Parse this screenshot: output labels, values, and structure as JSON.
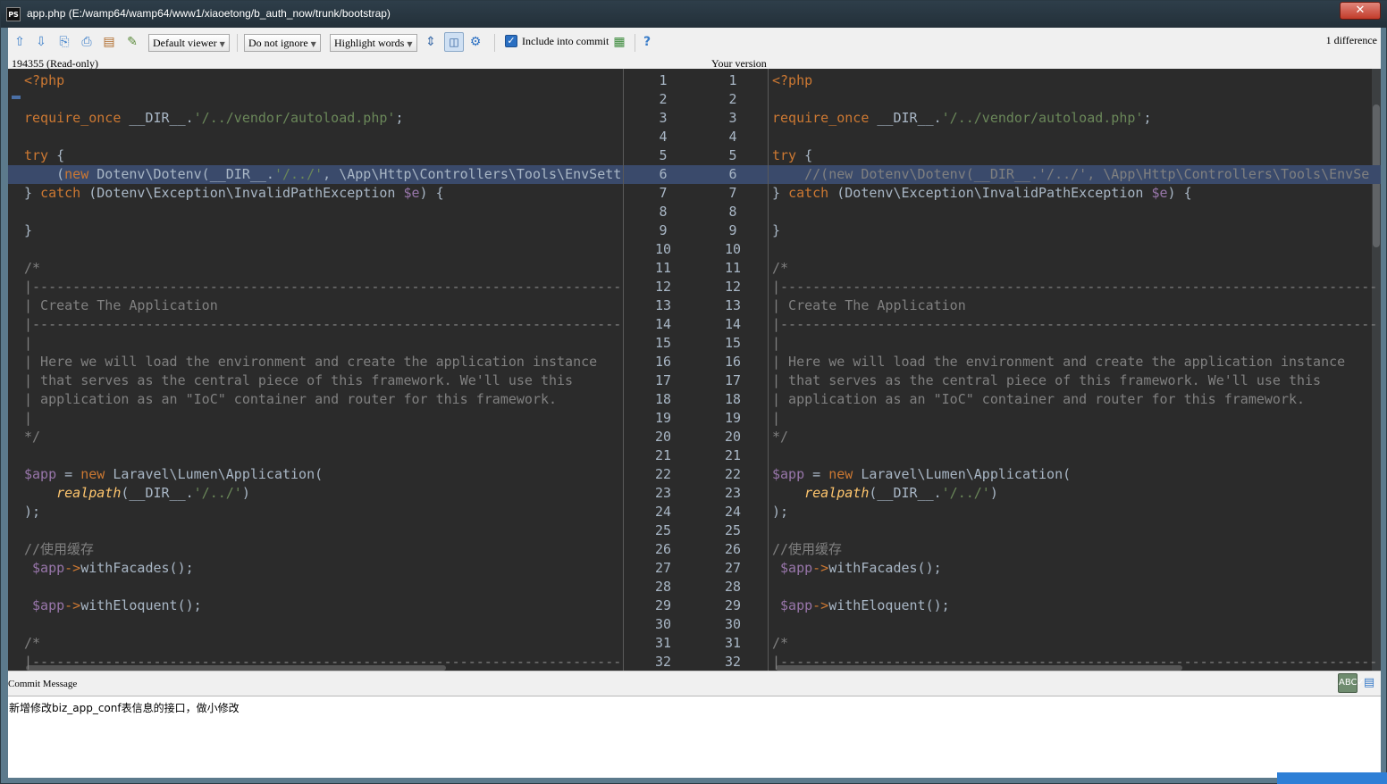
{
  "window": {
    "title": "app.php (E:/wamp64/wamp64/www1/xiaoetong/b_auth_now/trunk/bootstrap)",
    "app_icon_text": "PS",
    "close_glyph": "✕"
  },
  "toolbar": {
    "icons": [
      "up-arrow-icon",
      "down-arrow-icon",
      "prev-file-icon",
      "next-file-icon",
      "compare-icon",
      "edit-source-icon",
      "collapse-unchanged-icon",
      "side-by-side-icon",
      "settings-gear-icon",
      "help-icon"
    ],
    "viewer_dropdown": "Default viewer",
    "ignore_dropdown": "Do not ignore",
    "highlight_dropdown": "Highlight words",
    "include_commit_label": "Include into commit",
    "include_commit_checked": true,
    "help_glyph": "?",
    "difference_count": "1 difference"
  },
  "headers": {
    "left_revision": "194355 (Read-only)",
    "right_label": "Your version"
  },
  "diff": {
    "changed_line": 6,
    "line_numbers": [
      "1",
      "2",
      "3",
      "4",
      "5",
      "6",
      "7",
      "8",
      "9",
      "10",
      "11",
      "12",
      "13",
      "14",
      "15",
      "16",
      "17",
      "18",
      "19",
      "20",
      "21",
      "22",
      "23",
      "24",
      "25",
      "26",
      "27",
      "28",
      "29",
      "30",
      "31",
      "32"
    ],
    "left_lines": [
      "<?php",
      "",
      "require_once __DIR__.'/../vendor/autoload.php';",
      "",
      "try {",
      "    (new Dotenv\\Dotenv(__DIR__.'/../', \\App\\Http\\Controllers\\Tools\\EnvSett",
      "} catch (Dotenv\\Exception\\InvalidPathException $e) {",
      "",
      "}",
      "",
      "/*",
      "|--------------------------------------------------------------------------",
      "| Create The Application",
      "|--------------------------------------------------------------------------",
      "|",
      "| Here we will load the environment and create the application instance",
      "| that serves as the central piece of this framework. We'll use this",
      "| application as an \"IoC\" container and router for this framework.",
      "|",
      "*/",
      "",
      "$app = new Laravel\\Lumen\\Application(",
      "    realpath(__DIR__.'/../')",
      ");",
      "",
      "//使用缓存",
      " $app->withFacades();",
      "",
      " $app->withEloquent();",
      "",
      "/*",
      "|--------------------------------------------------------------------------"
    ],
    "right_lines": [
      "<?php",
      "",
      "require_once __DIR__.'/../vendor/autoload.php';",
      "",
      "try {",
      "    //(new Dotenv\\Dotenv(__DIR__.'/../', \\App\\Http\\Controllers\\Tools\\EnvSe",
      "} catch (Dotenv\\Exception\\InvalidPathException $e) {",
      "",
      "}",
      "",
      "/*",
      "|--------------------------------------------------------------------------",
      "| Create The Application",
      "|--------------------------------------------------------------------------",
      "|",
      "| Here we will load the environment and create the application instance",
      "| that serves as the central piece of this framework. We'll use this",
      "| application as an \"IoC\" container and router for this framework.",
      "|",
      "*/",
      "",
      "$app = new Laravel\\Lumen\\Application(",
      "    realpath(__DIR__.'/../')",
      ");",
      "",
      "//使用缓存",
      " $app->withFacades();",
      "",
      " $app->withEloquent();",
      "",
      "/*",
      "|--------------------------------------------------------------------------"
    ]
  },
  "commit": {
    "label": "Commit Message",
    "message": "新增修改biz_app_conf表信息的接口，做小修改",
    "spellcheck_glyph": "ABC✓",
    "history_glyph": "▤"
  },
  "colors": {
    "editor_bg": "#2b2b2b",
    "changed_line_bg": "#3a4a6b",
    "keyword": "#cc7832",
    "string": "#6a8759",
    "variable": "#9876aa",
    "comment": "#808080"
  }
}
